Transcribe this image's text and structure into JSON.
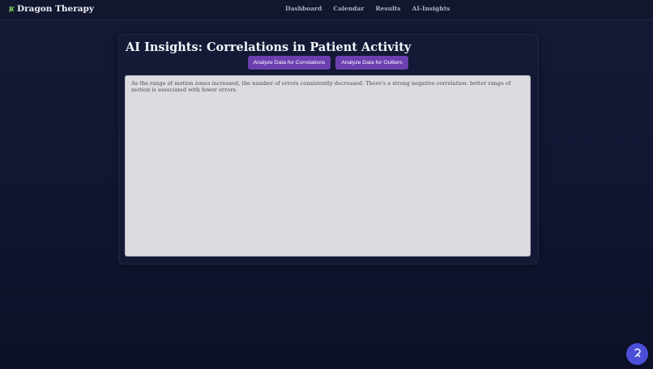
{
  "navbar": {
    "brand": "Dragon Therapy",
    "brand_icon": "dragon-icon",
    "links": [
      "Dashboard",
      "Calendar",
      "Results",
      "AI-Insights"
    ]
  },
  "main": {
    "title": "AI Insights: Correlations in Patient Activity",
    "buttons": {
      "correlations": "Analyze Data for Correlations",
      "outliers": "Analyze Data for Outliers"
    },
    "output_text": "As the range of motion zones increased, the number of errors consistently decreased. There's a strong negative correlation: better range of motion is associated with fewer errors."
  },
  "fab": {
    "icon": "assistant-icon"
  },
  "colors": {
    "background": "#111633",
    "navbar": "#12172f",
    "button": "#6b3fb0",
    "fab": "#4b4fd8",
    "output_box": "#dcdbe0"
  }
}
